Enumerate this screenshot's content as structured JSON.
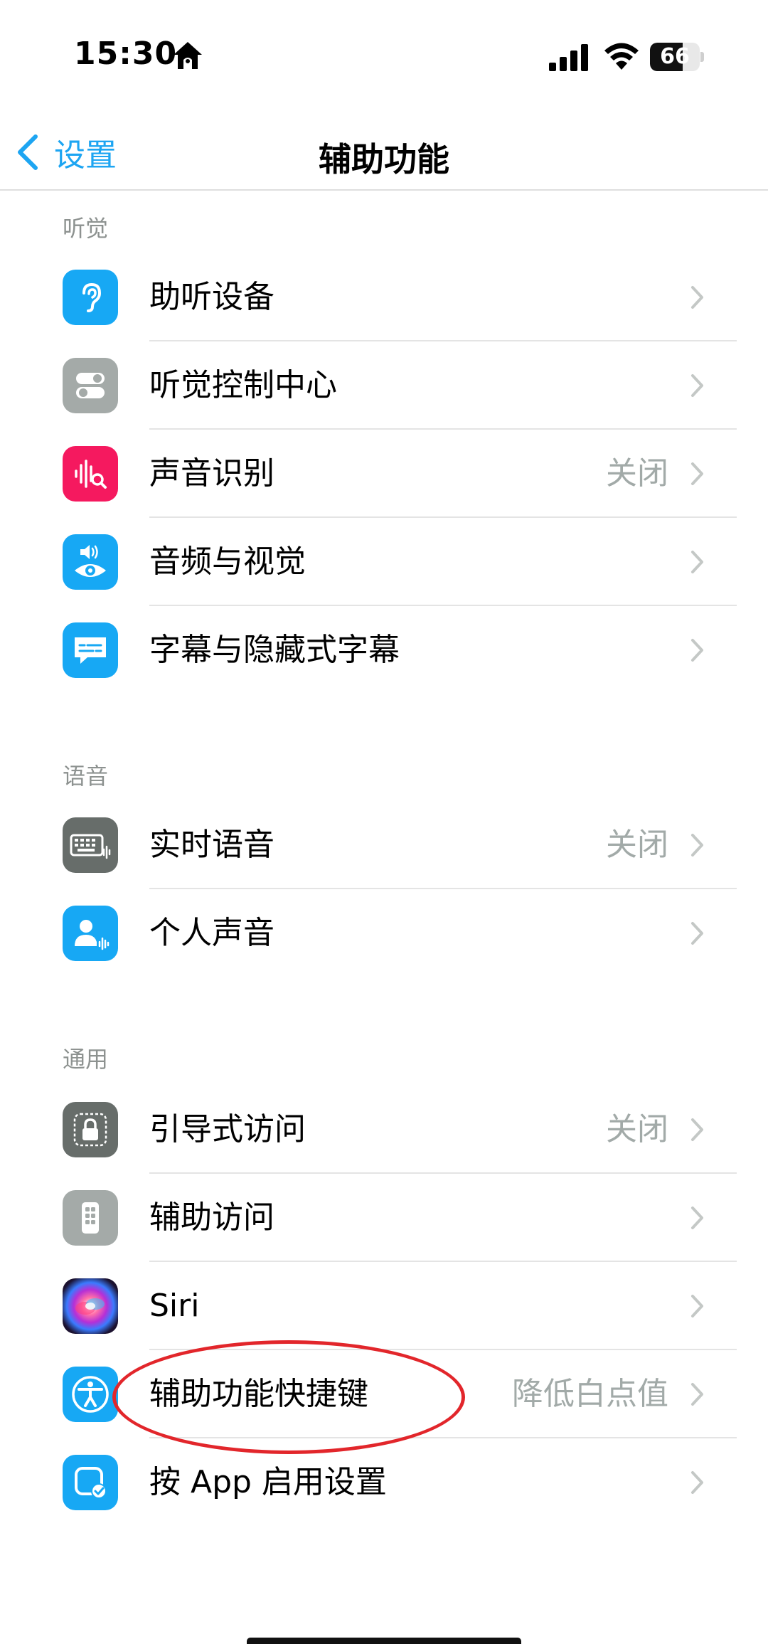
{
  "status_bar": {
    "time": "15:30",
    "battery_level": 66,
    "battery_text": "66"
  },
  "nav": {
    "back_label": "设置",
    "title": "辅助功能"
  },
  "sections": [
    {
      "header": "听觉",
      "items": [
        {
          "label": "助听设备",
          "value": "",
          "icon": "ear-icon",
          "icon_color": "#17a8f4"
        },
        {
          "label": "听觉控制中心",
          "value": "",
          "icon": "toggles-icon",
          "icon_color": "#a4aaa8"
        },
        {
          "label": "声音识别",
          "value": "关闭",
          "icon": "sound-recognition-icon",
          "icon_color": "#f5195f"
        },
        {
          "label": "音频与视觉",
          "value": "",
          "icon": "speaker-eye-icon",
          "icon_color": "#17a8f4"
        },
        {
          "label": "字幕与隐藏式字幕",
          "value": "",
          "icon": "captions-icon",
          "icon_color": "#17a8f4"
        }
      ]
    },
    {
      "header": "语音",
      "items": [
        {
          "label": "实时语音",
          "value": "关闭",
          "icon": "keyboard-waveform-icon",
          "icon_color": "#676d6a"
        },
        {
          "label": "个人声音",
          "value": "",
          "icon": "person-waveform-icon",
          "icon_color": "#17a8f4"
        }
      ]
    },
    {
      "header": "通用",
      "items": [
        {
          "label": "引导式访问",
          "value": "关闭",
          "icon": "lock-icon",
          "icon_color": "#676d6a"
        },
        {
          "label": "辅助访问",
          "value": "",
          "icon": "phone-grid-icon",
          "icon_color": "#a4aaa8"
        },
        {
          "label": "Siri",
          "value": "",
          "icon": "siri-icon",
          "icon_color": "#2a1b3a"
        },
        {
          "label": "辅助功能快捷键",
          "value": "降低白点值",
          "icon": "accessibility-icon",
          "icon_color": "#17a8f4"
        },
        {
          "label": "按 App 启用设置",
          "value": "",
          "icon": "app-checkmark-icon",
          "icon_color": "#17a8f4"
        }
      ]
    }
  ]
}
